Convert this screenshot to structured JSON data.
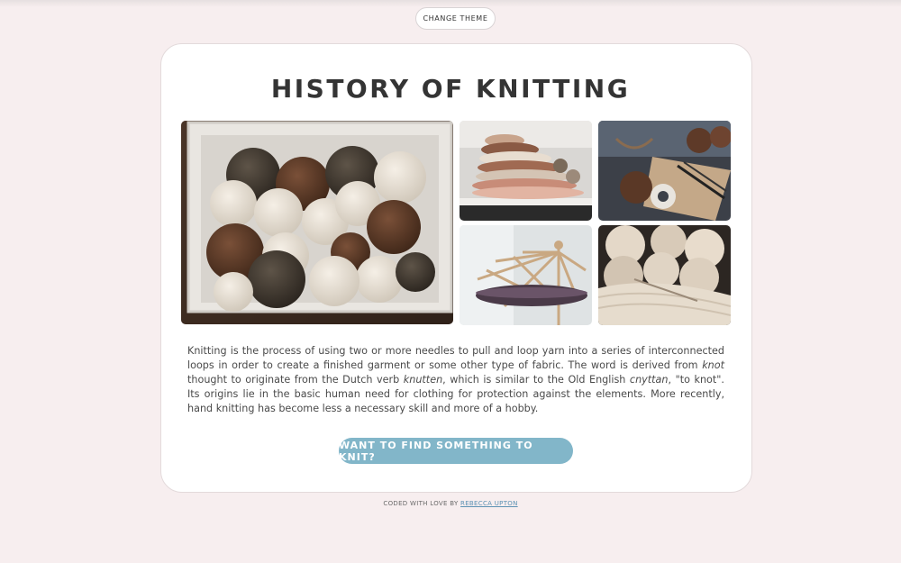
{
  "header": {
    "theme_button": "CHANGE THEME"
  },
  "main": {
    "title": "HISTORY OF KNITTING",
    "gallery_icons": [
      "yarn-box-photo",
      "yarn-shelf-photo",
      "knitting-tools-photo",
      "yarn-swift-photo",
      "knitted-fabric-photo"
    ],
    "description": {
      "p1": "Knitting is the process of using two or more needles to pull and loop yarn into a series of interconnected loops in order to create a finished garment or some other type of fabric. The word is derived from ",
      "e1": "knot",
      "p2": " thought to originate from the Dutch verb ",
      "e2": "knutten",
      "p3": ", which is similar to the Old English ",
      "e3": "cnyttan",
      "p4": ", \"to knot\". Its origins lie in the basic human need for clothing for protection against the elements. More recently, hand knitting has become less a necessary skill and more of a hobby."
    },
    "cta_label": "WANT TO FIND SOMETHING TO KNIT?"
  },
  "footer": {
    "prefix": "CODED WITH LOVE BY ",
    "author": "REBECCA UPTON"
  },
  "colors": {
    "background": "#f7eeef",
    "card": "#ffffff",
    "accent": "#82b6c9",
    "link": "#5d92b4"
  }
}
